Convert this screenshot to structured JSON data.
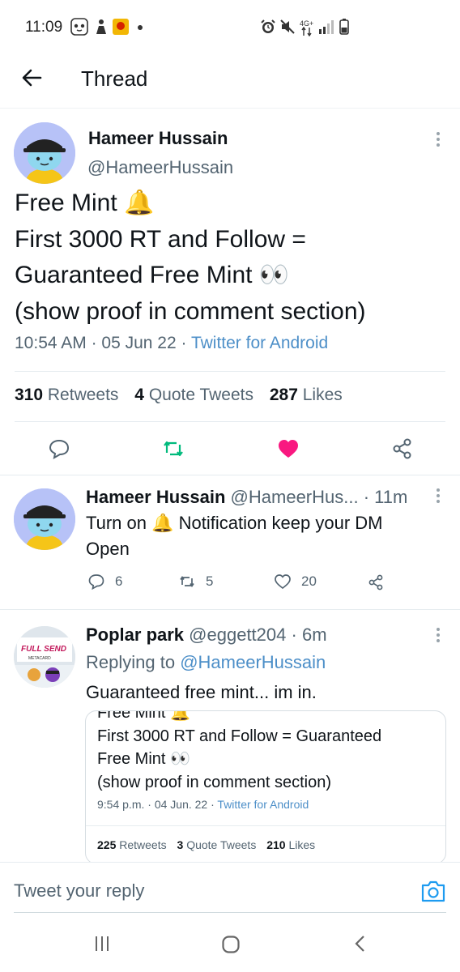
{
  "status_bar": {
    "time": "11:09",
    "network": "4G+"
  },
  "header": {
    "title": "Thread"
  },
  "main_tweet": {
    "author_name": "Hameer Hussain",
    "author_handle": "@HameerHussain",
    "text_line1": "Free Mint 🔔",
    "text_line2": "First 3000 RT and Follow  =",
    "text_line3": "Guaranteed Free Mint 👀",
    "text_line4": "(show proof in comment section)",
    "time": "10:54 AM",
    "date": "05 Jun 22",
    "source": "Twitter for Android",
    "retweets": "310",
    "retweets_label": "Retweets",
    "quotes": "4",
    "quotes_label": "Quote Tweets",
    "likes": "287",
    "likes_label": "Likes",
    "liked": true
  },
  "reply1": {
    "author_name": "Hameer Hussain",
    "author_handle": "@HameerHus...",
    "age": "· 11m",
    "text_line1": "Turn on 🔔 Notification keep your DM",
    "text_line2": "Open",
    "replies": "6",
    "retweets": "5",
    "likes": "20"
  },
  "reply2": {
    "author_name": "Poplar park",
    "author_handle": "@eggett204",
    "age": "· 6m",
    "replying_label": "Replying to",
    "replying_to": "@HameerHussain",
    "text": "Guaranteed free mint... im in.",
    "avatar_text1": "FULL SEND",
    "avatar_text2": "METACARD",
    "quote": {
      "text_line1": "Free Mint 🔔",
      "text_line2": "First 3000 RT and Follow  = Guaranteed",
      "text_line3": "Free Mint 👀",
      "text_line4": "(show proof in comment section)",
      "time": "9:54 p.m.",
      "date": "04 Jun. 22",
      "source": "Twitter for Android",
      "retweets": "225",
      "retweets_label": "Retweets",
      "quotes": "3",
      "quotes_label": "Quote Tweets",
      "likes": "210",
      "likes_label": "Likes"
    }
  },
  "reply_bar": {
    "placeholder": "Tweet your reply"
  },
  "colors": {
    "like": "#f91880",
    "retweet": "#00ba7c",
    "link": "#4d8fc8",
    "muted": "#536471"
  }
}
